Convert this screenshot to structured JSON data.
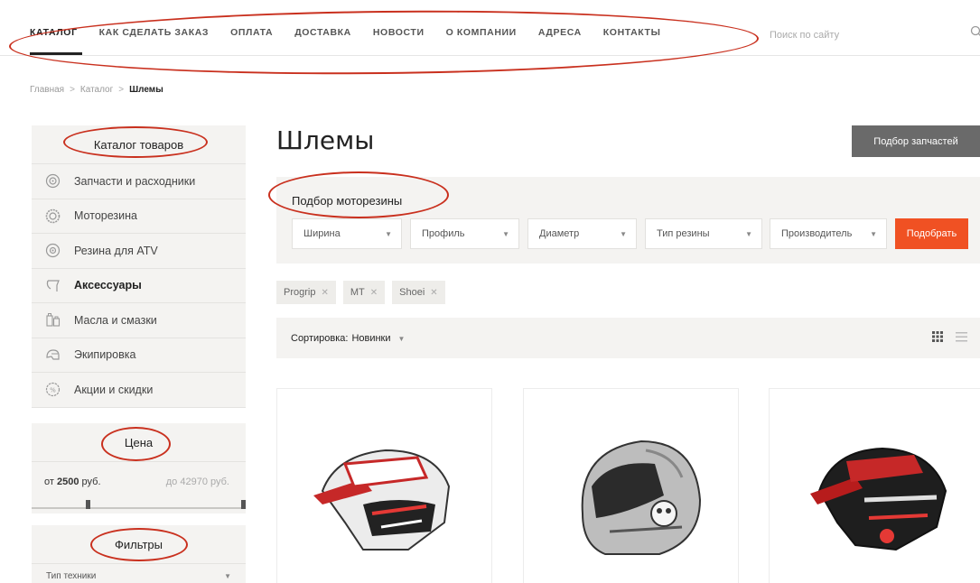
{
  "nav": {
    "items": [
      "КАТАЛОГ",
      "КАК СДЕЛАТЬ ЗАКАЗ",
      "ОПЛАТА",
      "ДОСТАВКА",
      "НОВОСТИ",
      "О КОМПАНИИ",
      "АДРЕСА",
      "КОНТАКТЫ"
    ],
    "search_placeholder": "Поиск по сайту"
  },
  "breadcrumb": {
    "home": "Главная",
    "catalog": "Каталог",
    "current": "Шлемы",
    "sep": ">"
  },
  "sidebar": {
    "catalog_title": "Каталог товаров",
    "categories": [
      {
        "label": "Запчасти и расходники",
        "icon": "brake-disc-icon"
      },
      {
        "label": "Моторезина",
        "icon": "tire-icon"
      },
      {
        "label": "Резина для ATV",
        "icon": "atv-tire-icon"
      },
      {
        "label": "Аксессуары",
        "icon": "mirror-icon"
      },
      {
        "label": "Масла и смазки",
        "icon": "oil-icon"
      },
      {
        "label": "Экипировка",
        "icon": "helmet-icon"
      },
      {
        "label": "Акции и скидки",
        "icon": "discount-icon"
      }
    ],
    "price_title": "Цена",
    "price_from_prefix": "от",
    "price_from": "2500",
    "price_to_prefix": "до",
    "price_to": "42970",
    "currency": "руб.",
    "filters_title": "Фильтры",
    "filter_first": "Тип техники"
  },
  "main": {
    "title": "Шлемы",
    "parts_button": "Подбор запчастей",
    "tire_title": "Подбор моторезины",
    "selects": [
      "Ширина",
      "Профиль",
      "Диаметр",
      "Тип резины",
      "Производитель"
    ],
    "pick_button": "Подобрать",
    "tags": [
      "Progrip",
      "MT",
      "Shoei"
    ],
    "sort_label": "Сортировка:",
    "sort_value": "Новинки"
  },
  "colors": {
    "accent": "#f05123",
    "annotation": "#c9301e",
    "panel": "#f4f3f1",
    "dark_button": "#6a6a6a"
  }
}
